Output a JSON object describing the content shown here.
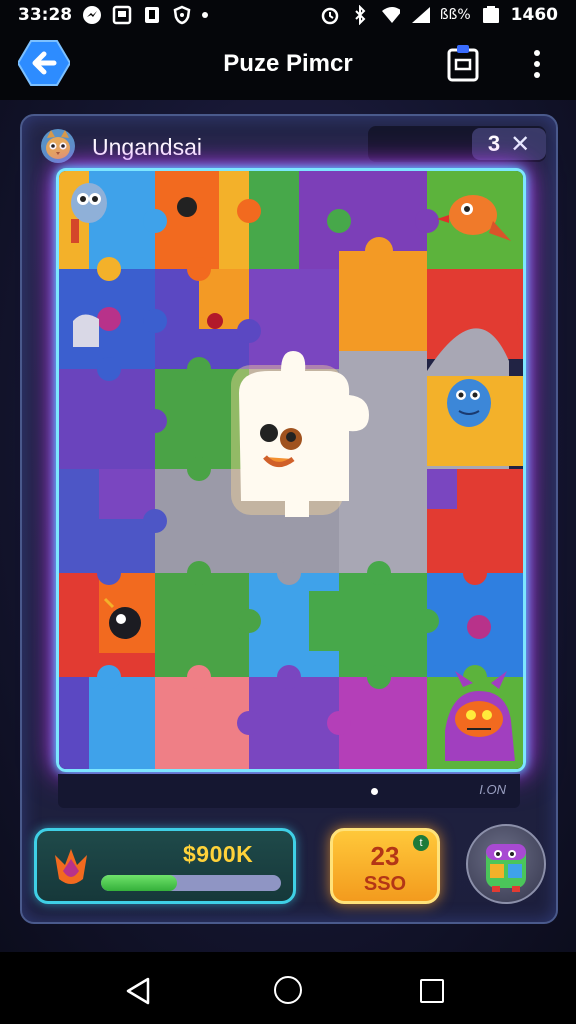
{
  "status_bar": {
    "time": "33:28",
    "battery_percent": "ßß%",
    "right_time": "1460",
    "icons": [
      "messenger-icon",
      "notes-icon",
      "notification-icon",
      "shield-icon",
      "dot-icon",
      "alarm-icon",
      "bluetooth-icon",
      "wifi-icon",
      "signal-icon",
      "battery-icon"
    ]
  },
  "app_bar": {
    "title": "Puze Pimcr",
    "icons": [
      "back-arrow-icon",
      "clipboard-icon",
      "more-vert-icon"
    ]
  },
  "game": {
    "player_name": "Ungandsai",
    "counter_value": "3",
    "counter_close": "✕",
    "strip_label": "I.ON",
    "score": {
      "value": "$900K",
      "progress": 0.42
    },
    "coin_button": {
      "top": "23",
      "bottom": "SSO",
      "badge": "t"
    }
  },
  "colors": {
    "board_glow_a": "#3ce0ff",
    "board_glow_b": "#c03cff",
    "score_text": "#ffd23a",
    "coin_bg": "#f6a623"
  },
  "nav_bar": {
    "icons": [
      "nav-back-icon",
      "nav-home-icon",
      "nav-recent-icon"
    ]
  }
}
